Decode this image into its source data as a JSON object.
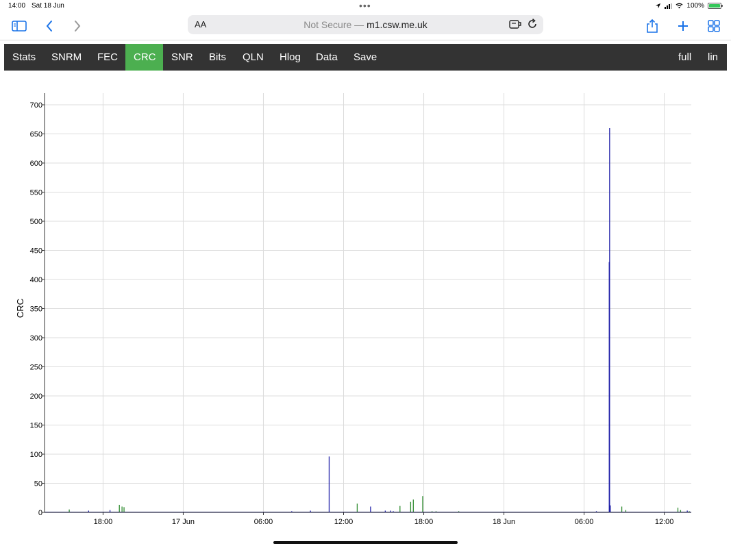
{
  "status_bar": {
    "time": "14:00",
    "date": "Sat 18 Jun",
    "battery": "100%",
    "battery_level": 1.0
  },
  "browser": {
    "aa_label": "AA",
    "url_prefix": "Not Secure — ",
    "url_domain": "m1.csw.me.uk",
    "icons": [
      "sidebar-icon",
      "back-icon",
      "forward-icon",
      "extension-icon",
      "reload-icon",
      "share-icon",
      "new-tab-icon",
      "tabs-overview-icon"
    ]
  },
  "nav": {
    "items": [
      {
        "label": "Stats",
        "active": false
      },
      {
        "label": "SNRM",
        "active": false
      },
      {
        "label": "FEC",
        "active": false
      },
      {
        "label": "CRC",
        "active": true
      },
      {
        "label": "SNR",
        "active": false
      },
      {
        "label": "Bits",
        "active": false
      },
      {
        "label": "QLN",
        "active": false
      },
      {
        "label": "Hlog",
        "active": false
      },
      {
        "label": "Data",
        "active": false
      },
      {
        "label": "Save",
        "active": false
      }
    ],
    "right_items": [
      {
        "label": "full"
      },
      {
        "label": "lin"
      }
    ],
    "colors": {
      "bar": "#333333",
      "active": "#4caf50",
      "text": "#ffffff"
    }
  },
  "chart_data": {
    "type": "bar",
    "title": "",
    "xlabel": "",
    "ylabel": "CRC",
    "ylim": [
      0,
      720
    ],
    "yticks": [
      0,
      50,
      100,
      150,
      200,
      250,
      300,
      350,
      400,
      450,
      500,
      550,
      600,
      650,
      700
    ],
    "x_unit": "hours since 16 Jun 13:00",
    "xlim": [
      0,
      48.4
    ],
    "xticks": [
      {
        "label": "18:00",
        "x": 4.38
      },
      {
        "label": "17 Jun",
        "x": 10.38
      },
      {
        "label": "06:00",
        "x": 16.38
      },
      {
        "label": "12:00",
        "x": 22.38
      },
      {
        "label": "18:00",
        "x": 28.38
      },
      {
        "label": "18 Jun",
        "x": 34.38
      },
      {
        "label": "06:00",
        "x": 40.38
      },
      {
        "label": "12:00",
        "x": 46.38
      }
    ],
    "grid": true,
    "series": [
      {
        "name": "",
        "color": "#2e8b2e",
        "points": [
          [
            1.85,
            5
          ],
          [
            5.6,
            13
          ],
          [
            5.8,
            10
          ],
          [
            5.95,
            9
          ],
          [
            23.4,
            15
          ],
          [
            26.6,
            11
          ],
          [
            27.4,
            18
          ],
          [
            27.6,
            22
          ],
          [
            28.3,
            28
          ],
          [
            29.0,
            2
          ],
          [
            29.3,
            2
          ],
          [
            31.0,
            2
          ],
          [
            43.2,
            10
          ],
          [
            43.5,
            4
          ],
          [
            47.4,
            8
          ],
          [
            47.6,
            4
          ],
          [
            48.25,
            2
          ]
        ]
      },
      {
        "name": "",
        "color": "#1f1fa8",
        "points": [
          [
            3.3,
            3
          ],
          [
            4.9,
            4
          ],
          [
            18.5,
            2
          ],
          [
            19.9,
            3
          ],
          [
            21.3,
            96
          ],
          [
            24.4,
            10
          ],
          [
            25.5,
            3
          ],
          [
            25.9,
            3
          ],
          [
            26.1,
            2
          ],
          [
            41.3,
            2
          ],
          [
            42.26,
            430
          ],
          [
            42.29,
            660
          ],
          [
            42.34,
            12
          ],
          [
            48.1,
            3
          ]
        ]
      }
    ]
  }
}
